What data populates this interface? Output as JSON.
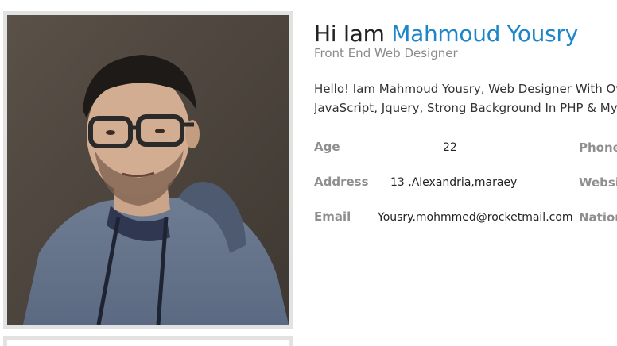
{
  "profile": {
    "greeting": "Hi Iam",
    "name": "Mahmoud Yousry",
    "title": "Front End Web Designer",
    "bio_line1": "Hello! Iam Mahmoud Yousry, Web Designer With Over",
    "bio_line2": "JavaScript, Jquery, Strong Background In PHP & MySQ",
    "accent_color": "#1d86c8"
  },
  "info_left": [
    {
      "label": "Age",
      "value": "22"
    },
    {
      "label": "Address",
      "value": "13 ,Alexandria,maraey"
    },
    {
      "label": "Email",
      "value": "Yousry.mohmmed@rocketmail.com"
    }
  ],
  "info_right": [
    {
      "label": "Phone"
    },
    {
      "label": "Website"
    },
    {
      "label": "Nationality"
    }
  ],
  "photo": {
    "subject": "portrait-photo"
  }
}
